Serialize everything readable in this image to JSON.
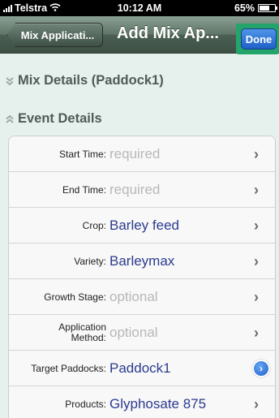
{
  "status_bar": {
    "carrier": "Telstra",
    "time": "10:12 AM",
    "battery": "65%",
    "battery_level": 0.65
  },
  "nav": {
    "back_label": "Mix Applicati...",
    "title": "Add Mix Ap...",
    "done_label": "Done"
  },
  "sections": {
    "mix_details": "Mix Details (Paddock1)",
    "event_details": "Event Details"
  },
  "rows": [
    {
      "label": "Start Time:",
      "value": "required",
      "kind": "placeholder",
      "accessory": "chevron"
    },
    {
      "label": "End Time:",
      "value": "required",
      "kind": "placeholder",
      "accessory": "chevron"
    },
    {
      "label": "Crop:",
      "value": "Barley feed",
      "kind": "filled",
      "accessory": "chevron"
    },
    {
      "label": "Variety:",
      "value": "Barleymax",
      "kind": "filled",
      "accessory": "chevron"
    },
    {
      "label": "Growth Stage:",
      "value": "optional",
      "kind": "placeholder",
      "accessory": "chevron"
    },
    {
      "label": "Application Method:",
      "value": "optional",
      "kind": "placeholder",
      "accessory": "chevron"
    },
    {
      "label": "Target Paddocks:",
      "value": "Paddock1",
      "kind": "filled",
      "accessory": "detail-disclosure"
    },
    {
      "label": "Products:",
      "value": "Glyphosate 875",
      "kind": "filled",
      "accessory": "chevron"
    }
  ],
  "colors": {
    "background": "#e6f1ee",
    "filled_value": "#2b3a8f",
    "placeholder": "#b8b8b8",
    "done_highlight": "#22a46b"
  }
}
